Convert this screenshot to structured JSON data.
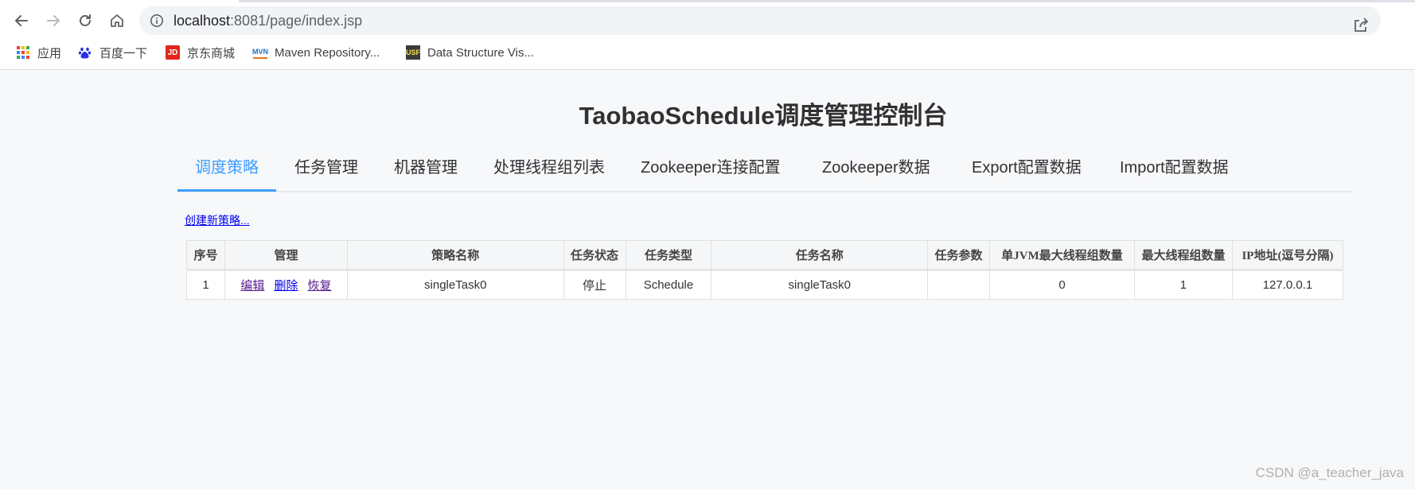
{
  "browser": {
    "url_host": "localhost",
    "url_rest": ":8081/page/index.jsp",
    "bookmarks": [
      {
        "label": "应用",
        "icon": "apps-grid-icon"
      },
      {
        "label": "百度一下",
        "icon": "baidu-paw-icon"
      },
      {
        "label": "京东商城",
        "icon": "jd-logo-icon",
        "icon_text": "JD"
      },
      {
        "label": "Maven Repository...",
        "icon": "mvn-logo-icon",
        "icon_text": "MVN"
      },
      {
        "label": "Data Structure Vis...",
        "icon": "usf-logo-icon",
        "icon_text": "USF"
      }
    ]
  },
  "page": {
    "title": "TaobaoSchedule调度管理控制台",
    "tabs": [
      "调度策略",
      "任务管理",
      "机器管理",
      "处理线程组列表",
      "Zookeeper连接配置",
      "Zookeeper数据",
      "Export配置数据",
      "Import配置数据"
    ],
    "active_tab": 0,
    "create_link": "创建新策略..."
  },
  "table": {
    "headers": [
      "序号",
      "管理",
      "策略名称",
      "任务状态",
      "任务类型",
      "任务名称",
      "任务参数",
      "单JVM最大线程组数量",
      "最大线程组数量",
      "IP地址(逗号分隔)"
    ],
    "rows": [
      {
        "index": "1",
        "actions": [
          "编辑",
          "删除",
          "恢复"
        ],
        "strategy_name": "singleTask0",
        "status": "停止",
        "type": "Schedule",
        "task_name": "singleTask0",
        "params": "",
        "jvm_max_groups": "0",
        "max_groups": "1",
        "ip": "127.0.0.1"
      }
    ]
  },
  "watermark": "CSDN @a_teacher_java",
  "colors": {
    "accent": "#409eff",
    "link": "#0000ee",
    "visited_link": "#551a8b"
  }
}
